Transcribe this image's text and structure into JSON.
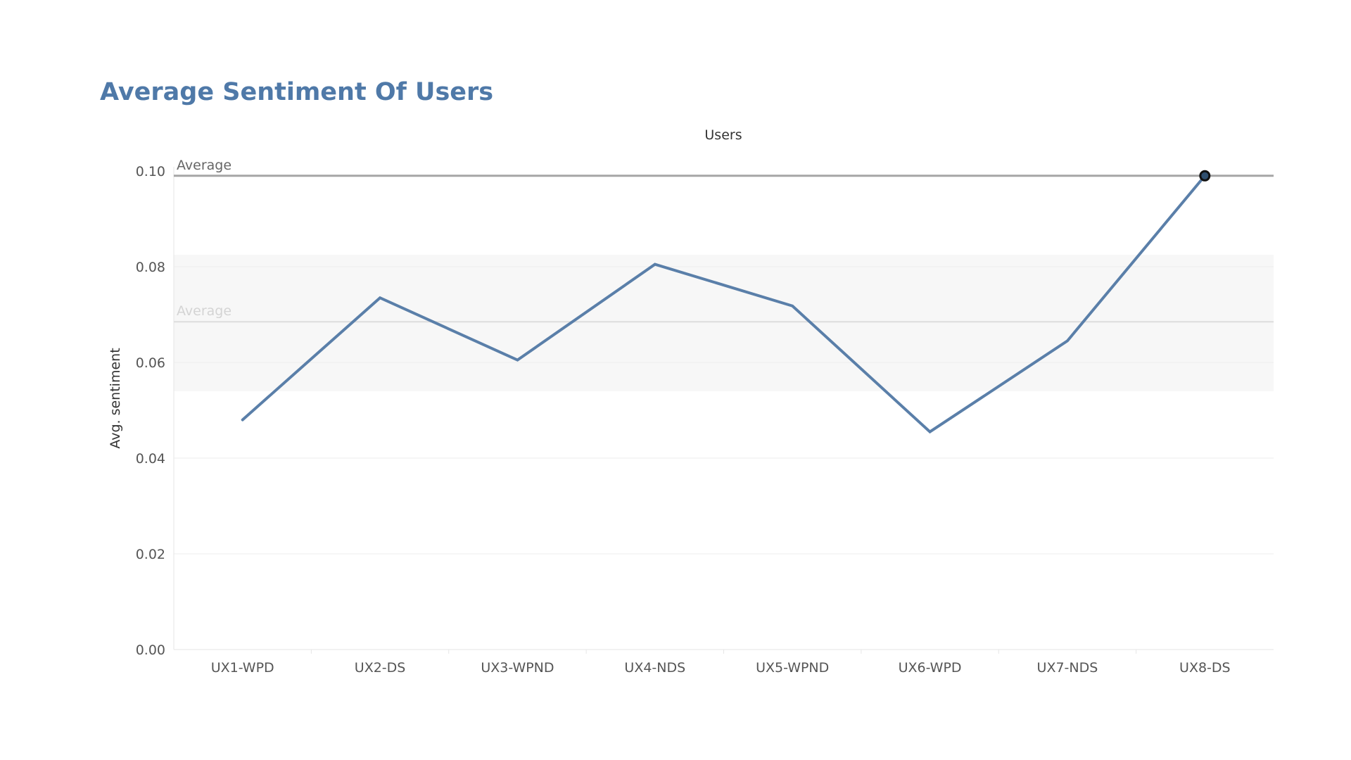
{
  "chart_data": {
    "type": "line",
    "title": "Average Sentiment Of Users",
    "xlabel": "Users",
    "ylabel": "Avg. sentiment",
    "categories": [
      "UX1-WPD",
      "UX2-DS",
      "UX3-WPND",
      "UX4-NDS",
      "UX5-WPND",
      "UX6-WPD",
      "UX7-NDS",
      "UX8-DS"
    ],
    "series": [
      {
        "values": [
          0.048,
          0.0735,
          0.0605,
          0.0805,
          0.0718,
          0.0455,
          0.0645,
          0.099
        ]
      }
    ],
    "yticks": [
      "0.00",
      "0.02",
      "0.04",
      "0.06",
      "0.08",
      "0.10"
    ],
    "ylim": [
      0,
      0.1
    ],
    "grid": true,
    "legend": "none",
    "reference_lines": [
      {
        "label": "Average",
        "value": 0.099,
        "color": "#a6a6a6",
        "label_color": "#666666"
      },
      {
        "label": "Average",
        "value": 0.0685,
        "color": "#dddddd",
        "label_color": "#d4d4d4"
      }
    ],
    "reference_band": {
      "from": 0.054,
      "to": 0.0825,
      "color": "#f7f7f7"
    },
    "highlighted_point": {
      "category": "UX8-DS",
      "value": 0.099
    },
    "line_color": "#5a7fa9"
  }
}
